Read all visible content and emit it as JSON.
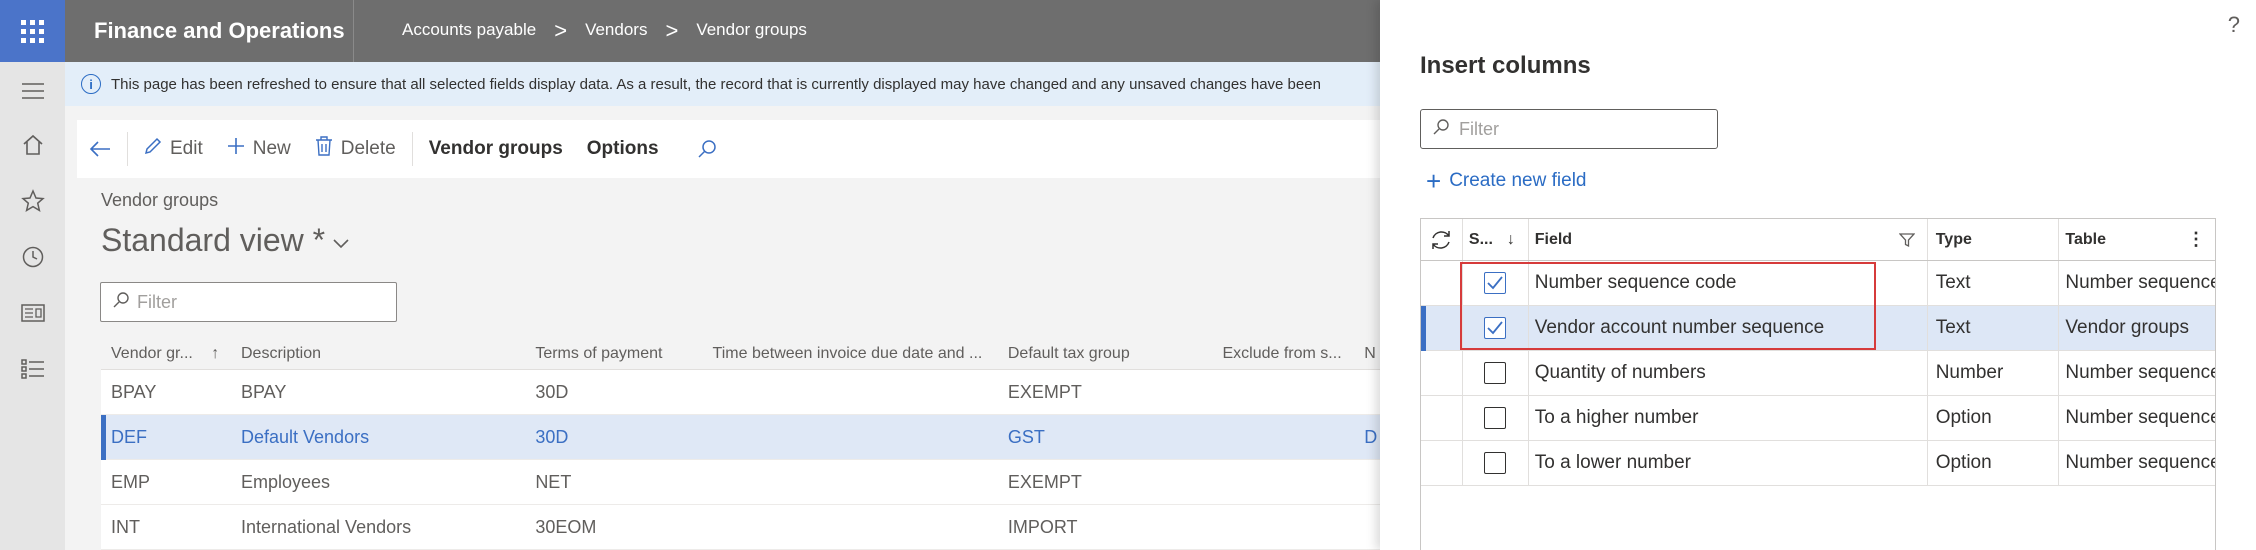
{
  "app": {
    "title": "Finance and Operations",
    "breadcrumb": [
      "Accounts payable",
      "Vendors",
      "Vendor groups"
    ],
    "breadcrumb_sep": ">"
  },
  "infobar": {
    "message": "This page has been refreshed to ensure that all selected fields display data. As a result, the record that is currently displayed may have changed and any unsaved changes have been"
  },
  "actions": {
    "edit": "Edit",
    "new": "New",
    "delete": "Delete",
    "vendor_groups": "Vendor groups",
    "options": "Options"
  },
  "page": {
    "subtitle": "Vendor groups",
    "view_title": "Standard view *",
    "filter_placeholder": "Filter"
  },
  "grid": {
    "headers": [
      "Vendor gr...",
      "Description",
      "Terms of payment",
      "Time between invoice due date and ...",
      "Default tax group",
      "Exclude from s...",
      "N"
    ],
    "rows": [
      {
        "group": "BPAY",
        "description": "BPAY",
        "terms": "30D",
        "time": "",
        "tax": "EXEMPT",
        "exclude": "",
        "n": ""
      },
      {
        "group": "DEF",
        "description": "Default Vendors",
        "terms": "30D",
        "time": "",
        "tax": "GST",
        "exclude": "",
        "n": "D"
      },
      {
        "group": "EMP",
        "description": "Employees",
        "terms": "NET",
        "time": "",
        "tax": "EXEMPT",
        "exclude": "",
        "n": ""
      },
      {
        "group": "INT",
        "description": "International Vendors",
        "terms": "30EOM",
        "time": "",
        "tax": "IMPORT",
        "exclude": "",
        "n": ""
      }
    ],
    "selected_row": 1
  },
  "panel": {
    "title": "Insert columns",
    "help": "?",
    "filter_placeholder": "Filter",
    "create_field": "Create new field",
    "headers": {
      "selected": "S...",
      "field": "Field",
      "type": "Type",
      "table": "Table"
    },
    "rows": [
      {
        "checked": true,
        "field": "Number sequence code",
        "type": "Text",
        "table": "Number sequence"
      },
      {
        "checked": true,
        "field": "Vendor account number sequence",
        "type": "Text",
        "table": "Vendor groups"
      },
      {
        "checked": false,
        "field": "Quantity of numbers",
        "type": "Number",
        "table": "Number sequence"
      },
      {
        "checked": false,
        "field": "To a higher number",
        "type": "Option",
        "table": "Number sequence"
      },
      {
        "checked": false,
        "field": "To a lower number",
        "type": "Option",
        "table": "Number sequence"
      }
    ],
    "selected_row": 1
  },
  "colors": {
    "accent": "#3b6fc3",
    "topbar": "#6e6e6e",
    "waffle": "#4b74c9",
    "highlight": "#d63b3b"
  }
}
